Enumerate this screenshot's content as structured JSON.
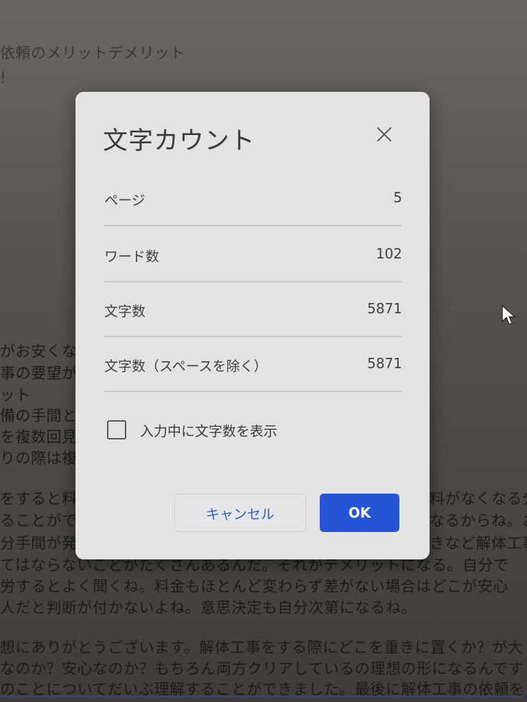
{
  "background_doc": {
    "lines_left": [
      "依頼のメリットデメリット",
      "!",
      "がお安くな",
      "事の要望が",
      "ット",
      "備の手間と",
      "を複数回見",
      "りの際は複",
      "をすると料",
      "ることがで",
      "分手間が発",
      "てはならないことがたくさんあるんだ。それがデメリットになる。自分で",
      "労するとよく聞くね。料金もほとんど変わらず差がない場合はどこが安心",
      "人だと判断が付かないよね。意思決定も自分次第になるね。",
      "想にありがとうございます。解体工事をする際にどこを重きに置くか？が大",
      "なのか？安心なのか？もちろん両方クリアしているの理想の形になるんです",
      "のことについてだいぶ理解することができました。最後に解体工事の依頼を"
    ],
    "lines_right": [
      "料がなくなる分",
      "なるからね。お",
      "きなど解体工事"
    ]
  },
  "dialog": {
    "title": "文字カウント",
    "stats": [
      {
        "label": "ページ",
        "value": "5"
      },
      {
        "label": "ワード数",
        "value": "102"
      },
      {
        "label": "文字数",
        "value": "5871"
      },
      {
        "label": "文字数（スペースを除く）",
        "value": "5871"
      }
    ],
    "checkbox_label": "入力中に文字数を表示",
    "checkbox_checked": false,
    "cancel_label": "キャンセル",
    "ok_label": "OK"
  },
  "icons": {
    "close": "close-icon",
    "cursor": "mouse-pointer-icon"
  },
  "colors": {
    "ok_button": "#2455d6",
    "cancel_text": "#2f62c9",
    "dialog_bg": "#e4e3e4"
  }
}
